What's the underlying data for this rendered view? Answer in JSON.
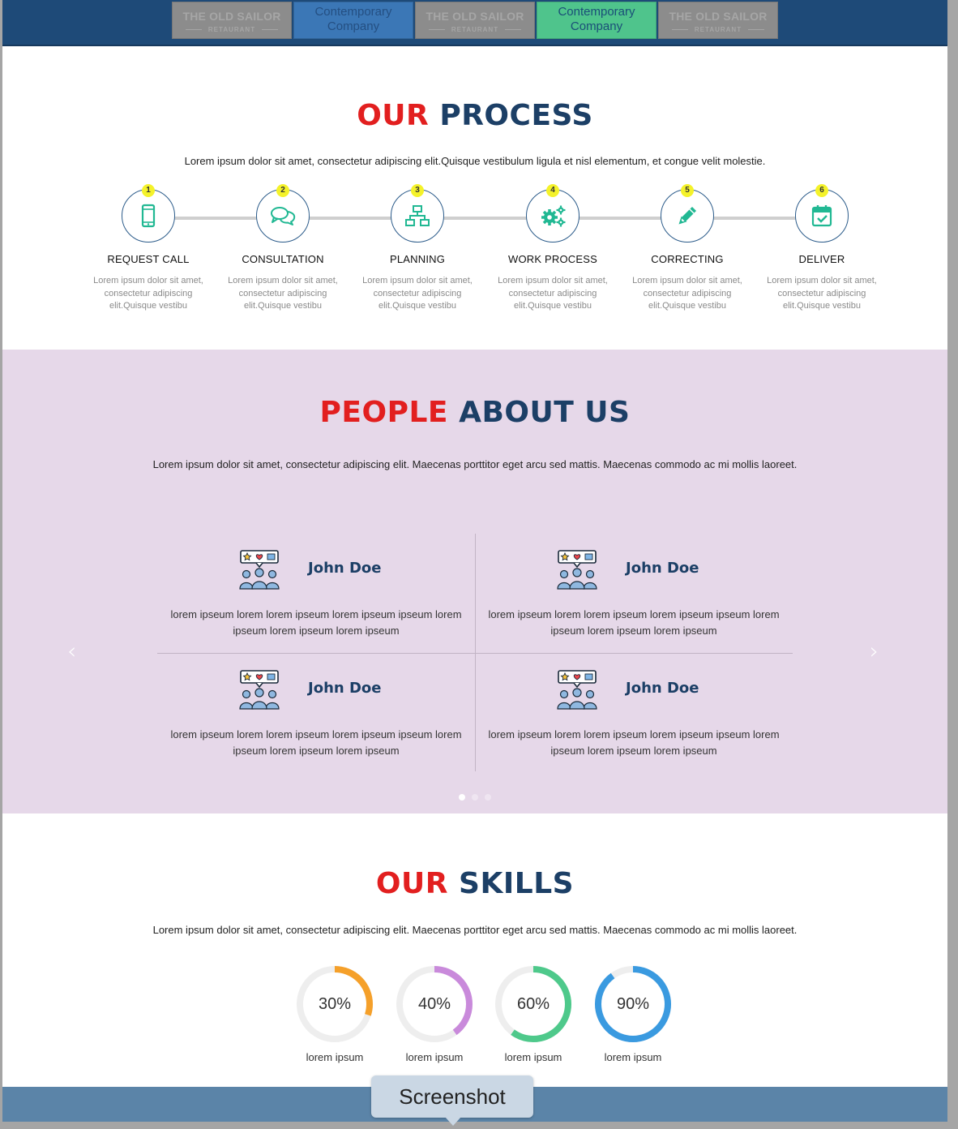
{
  "logo_strip": {
    "tiles": [
      {
        "line1": "THE OLD SAILOR",
        "line2": "RETAURANT"
      },
      {
        "line1": "Contemporary",
        "line2": "Company"
      },
      {
        "line1": "THE OLD SAILOR",
        "line2": "RETAURANT"
      },
      {
        "line1": "Contemporary",
        "line2": "Company"
      },
      {
        "line1": "THE OLD SAILOR",
        "line2": "RETAURANT"
      }
    ]
  },
  "process": {
    "title_red": "OUR",
    "title_blue": "PROCESS",
    "lead": "Lorem ipsum dolor sit amet, consectetur adipiscing elit.Quisque vestibulum ligula et nisl elementum, et congue velit molestie.",
    "steps": [
      {
        "num": "1",
        "title": "REQUEST CALL",
        "icon": "phone-icon",
        "text": "Lorem ipsum dolor sit amet, consectetur adipiscing elit.Quisque vestibu"
      },
      {
        "num": "2",
        "title": "CONSULTATION",
        "icon": "chat-icon",
        "text": "Lorem ipsum dolor sit amet, consectetur adipiscing elit.Quisque vestibu"
      },
      {
        "num": "3",
        "title": "PLANNING",
        "icon": "sitemap-icon",
        "text": "Lorem ipsum dolor sit amet, consectetur adipiscing elit.Quisque vestibu"
      },
      {
        "num": "4",
        "title": "WORK PROCESS",
        "icon": "gears-icon",
        "text": "Lorem ipsum dolor sit amet, consectetur adipiscing elit.Quisque vestibu"
      },
      {
        "num": "5",
        "title": "CORRECTING",
        "icon": "pencil-icon",
        "text": "Lorem ipsum dolor sit amet, consectetur adipiscing elit.Quisque vestibu"
      },
      {
        "num": "6",
        "title": "DELIVER",
        "icon": "calendar-check-icon",
        "text": "Lorem ipsum dolor sit amet, consectetur adipiscing elit.Quisque vestibu"
      }
    ]
  },
  "people": {
    "title_red": "PEOPLE",
    "title_blue": "ABOUT US",
    "lead": "Lorem ipsum dolor sit amet, consectetur adipiscing elit. Maecenas porttitor eget arcu sed mattis. Maecenas commodo ac mi mollis laoreet.",
    "cards": [
      {
        "name": "John Doe",
        "quote": "lorem ipseum lorem lorem ipseum lorem ipseum ipseum lorem ipseum lorem ipseum lorem ipseum"
      },
      {
        "name": "John Doe",
        "quote": "lorem ipseum lorem lorem ipseum lorem ipseum ipseum lorem ipseum lorem ipseum lorem ipseum"
      },
      {
        "name": "John Doe",
        "quote": "lorem ipseum lorem lorem ipseum lorem ipseum ipseum lorem ipseum lorem ipseum lorem ipseum"
      },
      {
        "name": "John Doe",
        "quote": "lorem ipseum lorem lorem ipseum lorem ipseum ipseum lorem ipseum lorem ipseum lorem ipseum"
      }
    ],
    "prev_arrow": "‹",
    "next_arrow": "›",
    "slides": 3,
    "active_slide": 1
  },
  "skills": {
    "title_red": "OUR",
    "title_blue": "SKILLS",
    "lead": "Lorem ipsum dolor sit amet, consectetur adipiscing elit. Maecenas porttitor eget arcu sed mattis. Maecenas commodo ac mi mollis laoreet.",
    "items": [
      {
        "value": 30,
        "label_pct": "30%",
        "label": "lorem ipsum",
        "color": "#f5a02a"
      },
      {
        "value": 40,
        "label_pct": "40%",
        "label": "lorem ipsum",
        "color": "#c98adb"
      },
      {
        "value": 60,
        "label_pct": "60%",
        "label": "lorem ipsum",
        "color": "#4ec98b"
      },
      {
        "value": 90,
        "label_pct": "90%",
        "label": "lorem ipsum",
        "color": "#3a9ae0"
      }
    ]
  },
  "tooltip": {
    "text": "Screenshot"
  },
  "colors": {
    "accent_red": "#e21f1f",
    "accent_navy": "#1c3f66",
    "icon_teal": "#21b893",
    "people_bg": "#e6d8e9"
  }
}
